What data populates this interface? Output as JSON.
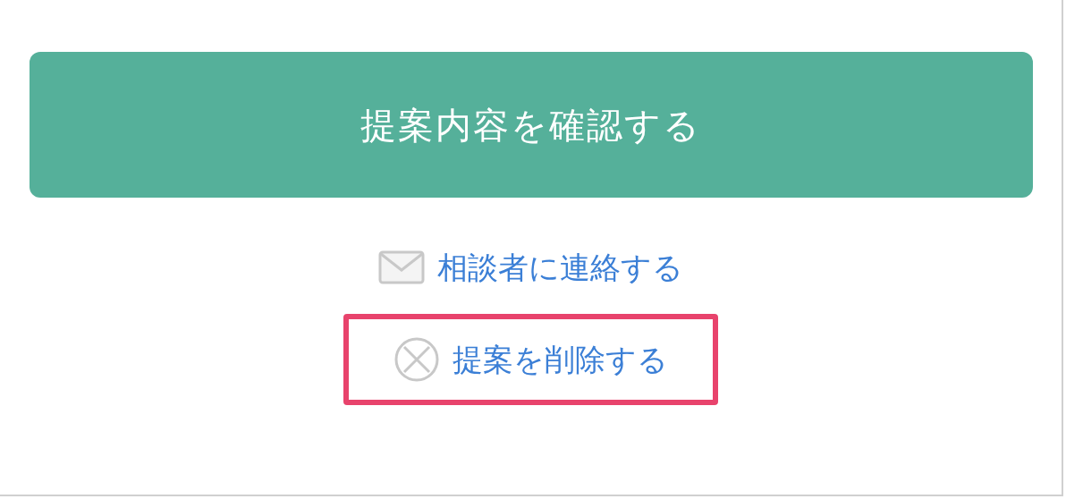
{
  "primary_button": {
    "label": "提案内容を確認する"
  },
  "links": [
    {
      "kind": "mail",
      "label": "相談者に連絡する",
      "highlighted": false
    },
    {
      "kind": "delete",
      "label": "提案を削除する",
      "highlighted": true
    }
  ]
}
